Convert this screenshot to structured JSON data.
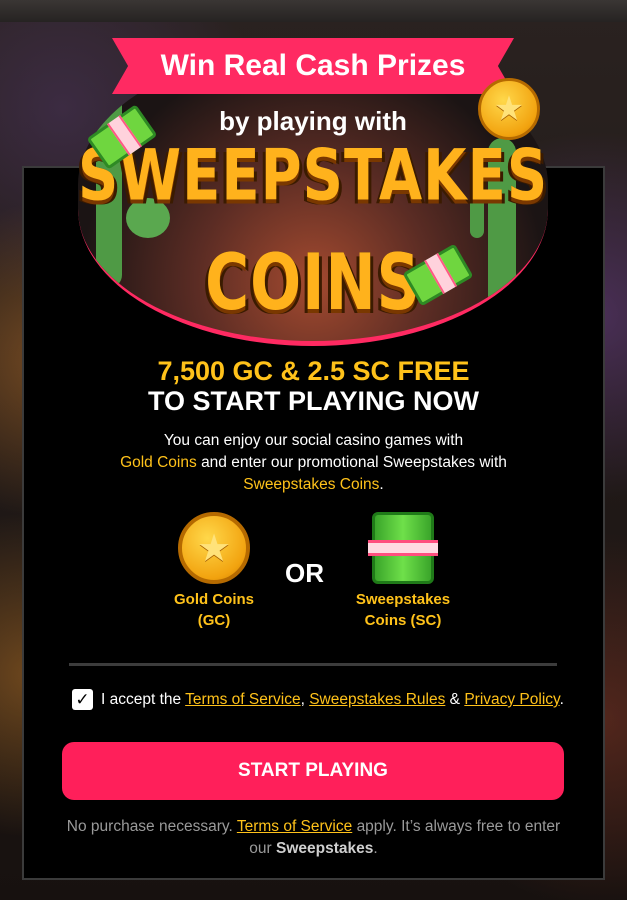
{
  "hero": {
    "ribbon_text": "Win Real Cash Prizes",
    "subtitle": "by playing with",
    "brand_line1": "SWEEPSTAKES",
    "brand_line2": "COINS",
    "coin_icon": "star-coin-icon",
    "cash_icon": "cash-bundle-icon"
  },
  "offer": {
    "line1": "7,500 GC & 2.5 SC FREE",
    "line2": "TO START PLAYING NOW"
  },
  "description": {
    "part1": "You can enjoy our social casino games with",
    "gold_coins": "Gold Coins",
    "part2": "and enter our promotional Sweepstakes with",
    "sweepstakes_coins": "Sweepstakes Coins",
    "end": "."
  },
  "currencies": {
    "gold": {
      "line1": "Gold Coins",
      "line2": "(GC)",
      "icon": "gold-coin-icon"
    },
    "or": "OR",
    "sweeps": {
      "line1": "Sweepstakes",
      "line2": "Coins (SC)",
      "icon": "sweepstakes-cash-icon"
    }
  },
  "terms": {
    "checked": true,
    "checkmark": "✓",
    "prefix": "I accept the",
    "tos": "Terms of Service",
    "comma": ",",
    "rules": "Sweepstakes Rules",
    "amp": "&",
    "privacy": "Privacy Policy",
    "end": "."
  },
  "cta_label": "START PLAYING",
  "footer": {
    "part1": "No purchase necessary.",
    "tos": "Terms of Service",
    "part2": "apply. It’s always free to enter our",
    "bold": "Sweepstakes",
    "end": "."
  },
  "colors": {
    "accent": "#ff1f5a",
    "gold": "#ffc21a",
    "modal_bg": "#000000"
  }
}
